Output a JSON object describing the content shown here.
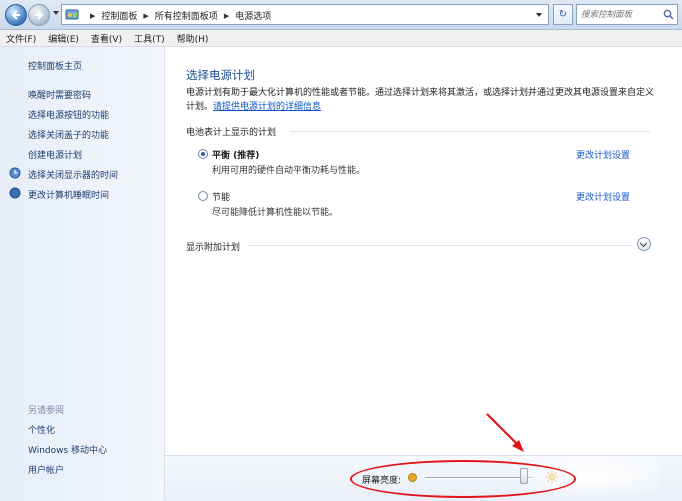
{
  "addressbar": {
    "crumbs": [
      "控制面板",
      "所有控制面板项",
      "电源选项"
    ],
    "search_placeholder": "搜索控制面板"
  },
  "menu": {
    "items": [
      "文件(F)",
      "编辑(E)",
      "查看(V)",
      "工具(T)",
      "帮助(H)"
    ]
  },
  "sidebar": {
    "home": "控制面板主页",
    "links": [
      "唤醒时需要密码",
      "选择电源按钮的功能",
      "选择关闭盖子的功能",
      "创建电源计划",
      "选择关闭显示器的时间",
      "更改计算机睡眠时间"
    ],
    "see_also_title": "另请参阅",
    "see_also": [
      "个性化",
      "Windows 移动中心",
      "用户帐户"
    ]
  },
  "main": {
    "title": "选择电源计划",
    "desc_text": "电源计划有助于最大化计算机的性能或者节能。通过选择计划来将其激活，或选择计划并通过更改其电源设置来自定义计划。",
    "desc_link": "请提供电源计划的详细信息",
    "section_label": "电池表计上显示的计划",
    "plans": [
      {
        "name": "平衡 (推荐)",
        "desc": "利用可用的硬件自动平衡功耗与性能。",
        "selected": true
      },
      {
        "name": "节能",
        "desc": "尽可能降低计算机性能以节能。",
        "selected": false
      }
    ],
    "change_link": "更改计划设置",
    "extra_label": "显示附加计划",
    "brightness_label": "屏幕亮度:",
    "brightness_level": 0.92
  },
  "colors": {
    "link": "#1e3d6e",
    "title": "#1b4e90",
    "annotation": "#e2141b"
  }
}
